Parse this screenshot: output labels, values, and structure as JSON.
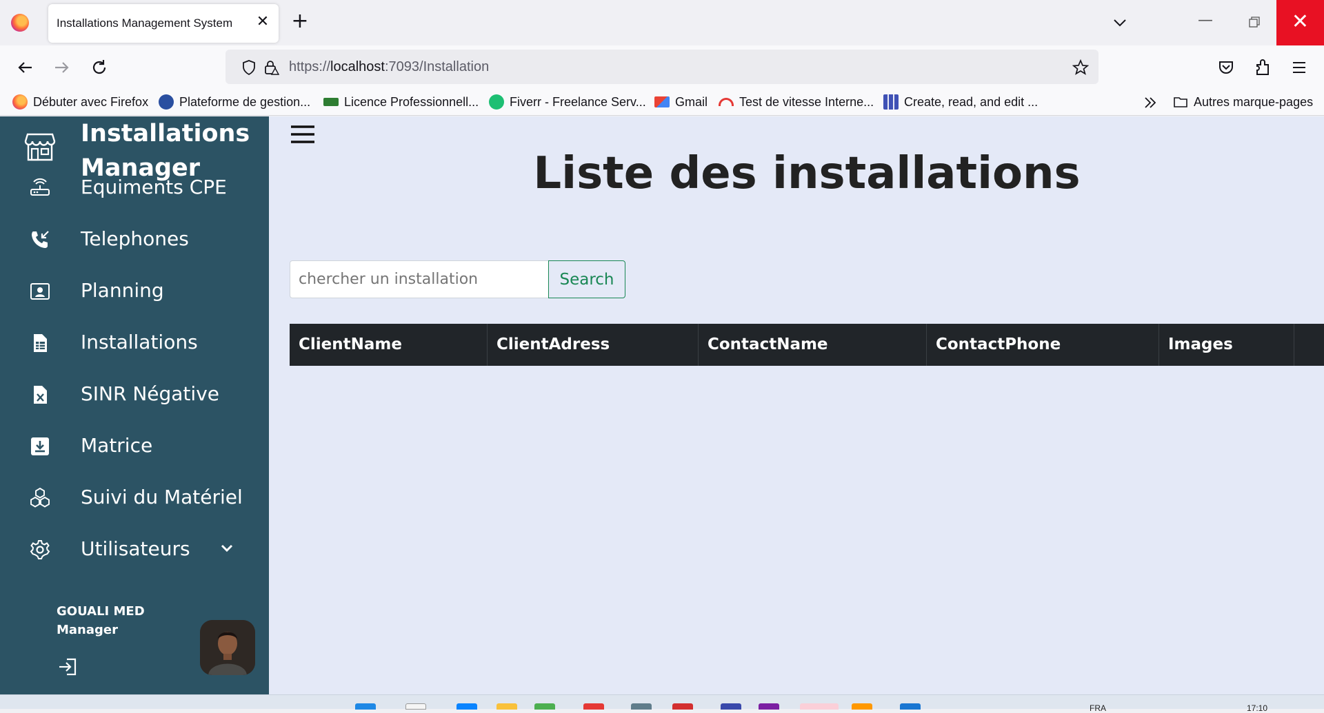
{
  "browser": {
    "tab_title": "Installations Management System",
    "url_prefix": "https://",
    "url_host": "localhost",
    "url_rest": ":7093/Installation",
    "bookmarks": [
      {
        "label": "Débuter avec Firefox",
        "icon": "firefox-icon"
      },
      {
        "label": "Plateforme de gestion...",
        "icon": "globe-icon"
      },
      {
        "label": "Licence Professionnell...",
        "icon": "graduation-cap-icon"
      },
      {
        "label": "Fiverr - Freelance Serv...",
        "icon": "fiverr-icon"
      },
      {
        "label": "Gmail",
        "icon": "gmail-icon"
      },
      {
        "label": "Test de vitesse Interne...",
        "icon": "speedometer-icon"
      },
      {
        "label": "Create, read, and edit ...",
        "icon": "grid-app-icon"
      }
    ],
    "other_bookmarks": "Autres marque-pages"
  },
  "sidebar": {
    "brand": "Installations Manager",
    "items": [
      {
        "label": "Equiments CPE",
        "icon": "router-icon"
      },
      {
        "label": "Telephones",
        "icon": "phone-incoming-icon"
      },
      {
        "label": "Planning",
        "icon": "id-card-icon"
      },
      {
        "label": "Installations",
        "icon": "spreadsheet-icon"
      },
      {
        "label": "SINR Négative",
        "icon": "file-x-icon"
      },
      {
        "label": "Matrice",
        "icon": "download-box-icon"
      },
      {
        "label": "Suivi du Matériel",
        "icon": "cubes-icon"
      },
      {
        "label": "Utilisateurs",
        "icon": "gear-icon"
      }
    ],
    "profile": {
      "name": "GOUALI MED",
      "role": "Manager"
    }
  },
  "main": {
    "title": "Liste des installations",
    "search_placeholder": "chercher un installation",
    "search_button": "Search",
    "columns": [
      "ClientName",
      "ClientAdress",
      "ContactName",
      "ContactPhone",
      "Images"
    ]
  },
  "taskbar": {
    "lang": "FRA",
    "time": "17:10"
  },
  "colors": {
    "sidebar_bg": "#2c5364",
    "content_bg": "#e4e9f7",
    "table_header_bg": "#212529",
    "search_accent": "#198754",
    "close_button": "#e81123"
  }
}
